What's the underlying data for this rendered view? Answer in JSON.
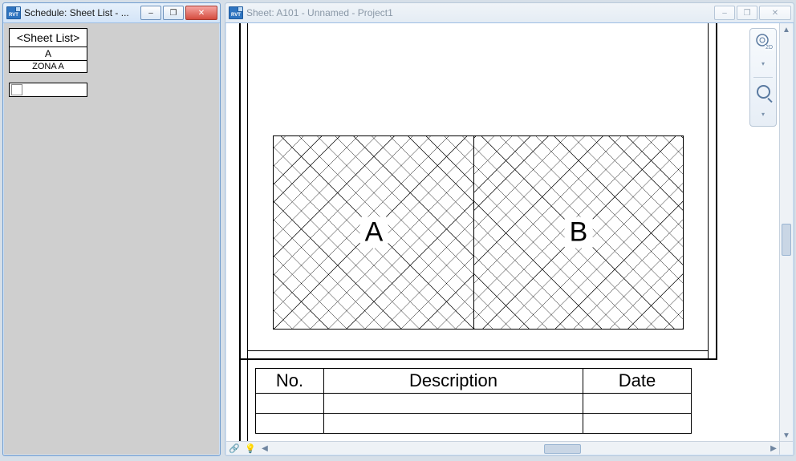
{
  "left_window": {
    "title": "Schedule: Sheet List - ...",
    "icon_text": "RVT",
    "schedule": {
      "title": "<Sheet List>",
      "header": "A",
      "rows": [
        "ZONA A"
      ]
    },
    "buttons": {
      "min": "–",
      "max": "❐",
      "close": "✕"
    }
  },
  "right_window": {
    "title": "Sheet: A101 - Unnamed - Project1",
    "icon_text": "RVT",
    "buttons": {
      "min": "–",
      "max": "❐",
      "close": "✕"
    },
    "regions": {
      "a": "A",
      "b": "B"
    },
    "rev_table": {
      "headers": {
        "no": "No.",
        "desc": "Description",
        "date": "Date"
      }
    },
    "navbar": {
      "mode": "2D"
    },
    "statusbar": {
      "icon1": "🔗",
      "icon2": "💡"
    }
  }
}
